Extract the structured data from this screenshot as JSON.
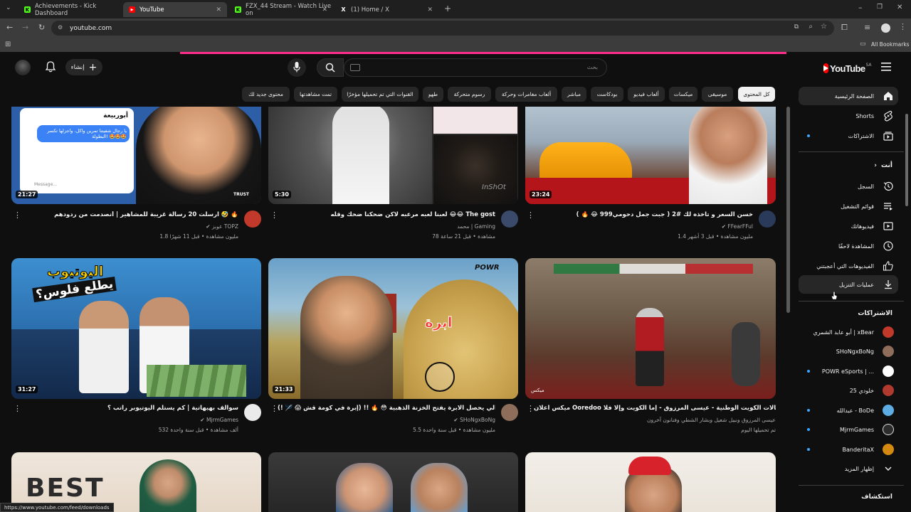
{
  "browser": {
    "tabs": [
      {
        "title": "Achievements - Kick Dashboard",
        "color": "#53fc18",
        "glyph": "K"
      },
      {
        "title": "YouTube",
        "color": "#ff0000",
        "glyph": "▶"
      },
      {
        "title": "FZX_44 Stream - Watch Live on",
        "color": "#53fc18",
        "glyph": "K"
      },
      {
        "title": "(1) Home / X",
        "color": "#ffffff",
        "glyph": "X"
      }
    ],
    "url": "youtube.com",
    "all_bookmarks": "All Bookmarks",
    "status_url": "https://www.youtube.com/feed/downloads"
  },
  "header": {
    "logo_text": "YouTube",
    "region": "SA",
    "search_placeholder": "بحث",
    "create_label": "إنشاء"
  },
  "chips": [
    "كل المحتوى",
    "موسيقى",
    "ميكسات",
    "ألعاب فيديو",
    "بودكاست",
    "مباشر",
    "ألعاب مغامرات وحركة",
    "رسوم متحركة",
    "طهو",
    "القنوات التي تم تحميلها مؤخرًا",
    "تمت مشاهدتها",
    "محتوى جديد لك"
  ],
  "sidebar": {
    "main": [
      {
        "label": "الصفحة الرئيسية",
        "icon": "home-icon"
      },
      {
        "label": "Shorts",
        "icon": "shorts-icon"
      },
      {
        "label": "الاشتراكات",
        "icon": "subscriptions-icon"
      }
    ],
    "you_label": "أنت",
    "you_items": [
      {
        "label": "السجل",
        "icon": "history-icon"
      },
      {
        "label": "قوائم التشغيل",
        "icon": "playlists-icon"
      },
      {
        "label": "فيديوهاتك",
        "icon": "your-videos-icon"
      },
      {
        "label": "المشاهدة لاحقًا",
        "icon": "watch-later-icon"
      },
      {
        "label": "الفيديوهات التي أعجبتني",
        "icon": "liked-icon"
      },
      {
        "label": "عمليات التنزيل",
        "icon": "download-icon"
      }
    ],
    "subs_heading": "الاشتراكات",
    "subscriptions": [
      {
        "label": "أبو عابد الشمري | xBear",
        "color": "#c0392b",
        "dot": false
      },
      {
        "label": "SHoNgxBoNg",
        "color": "#8e6e5a",
        "dot": false
      },
      {
        "label": "POWR eSports | ...",
        "color": "#ffffff",
        "dot": true
      },
      {
        "label": "خلودي 25",
        "color": "#b03a2e",
        "dot": false
      },
      {
        "label": "عبدالله - BoDe",
        "color": "#5dade2",
        "dot": true
      },
      {
        "label": "MjrmGames",
        "color": "#2c2c2c",
        "dot": true
      },
      {
        "label": "BanderitaX",
        "color": "#d68910",
        "dot": true
      }
    ],
    "show_more": "إظهار المزيد",
    "explore_heading": "استكشاف"
  },
  "videos": [
    {
      "duration": "23:24",
      "title": "خسن السعر و تاخذه لك #2 ( جبت جمل دحومي999 😂 🔥 )",
      "channel": "FFearFFul",
      "meta": "1.4 مليون مشاهدة • قبل 3 أشهر",
      "verified": true
    },
    {
      "duration": "5:30",
      "title": "لعبنا لعبه مرعبه لاكن ضحكنا ضحك وقله 😂😂 The gost",
      "channel": "محمد | Gaming",
      "meta": "78 مشاهدة • قبل 21 ساعة",
      "verified": false
    },
    {
      "duration": "21:27",
      "title": "ارسلت 20 رسالة غريبة للمشاهير | أنصدمت من ردودهم 🤣 🔥",
      "channel": "عوبز TOPZ",
      "meta": "1.8 مليون مشاهدة • قبل 11 شهرًا",
      "verified": true
    },
    {
      "duration": "",
      "title": "ميكس اعلان Ooredoo لاحتفالات الكويت الوطنية - عيسى المرزوق - إما الكويت وإلا فلا",
      "channel": "عيسى المرزوق ونبيل شعيل وبشار الشطي وفنانون آخرون",
      "meta": "تم تحميلها اليوم",
      "verified": false
    },
    {
      "duration": "21:33",
      "title": "الي يحصل الابرة يفتح الخزنة الذهبية 😳 🔥 !! (إبرة في كومة قش 😱 🪡 !)",
      "channel": "SHoNgxBoNg",
      "meta": "5.5 مليون مشاهدة • قبل سنة واحدة",
      "verified": true
    },
    {
      "duration": "31:27",
      "title": "سوالف بهيهاتية | كم يستلم اليوتيوبر راتب ؟",
      "channel": "MjrmGames",
      "meta": "532 ألف مشاهدة • قبل سنة واحدة",
      "verified": true
    }
  ],
  "thumb_text": {
    "t3_name": "أبوربيعة",
    "t3_msg": "يا رجال شفيتنا تمرين واكل، واجزلها تكسر البطولة! 🤩🤩🤩",
    "t3_compose": "Message...",
    "t3_brand": "TRUST",
    "t2_watermark": "InShOt",
    "t4_channel": "ميكس",
    "t5_word": "ابرة",
    "t5_brand": "POWR",
    "t6_line1": "اليوتيوب",
    "t6_line2": "يطلع فلوس؟",
    "t7_text": "BEST"
  },
  "colors": {
    "accent": "#3ea6ff",
    "brand_red": "#ff0000"
  }
}
